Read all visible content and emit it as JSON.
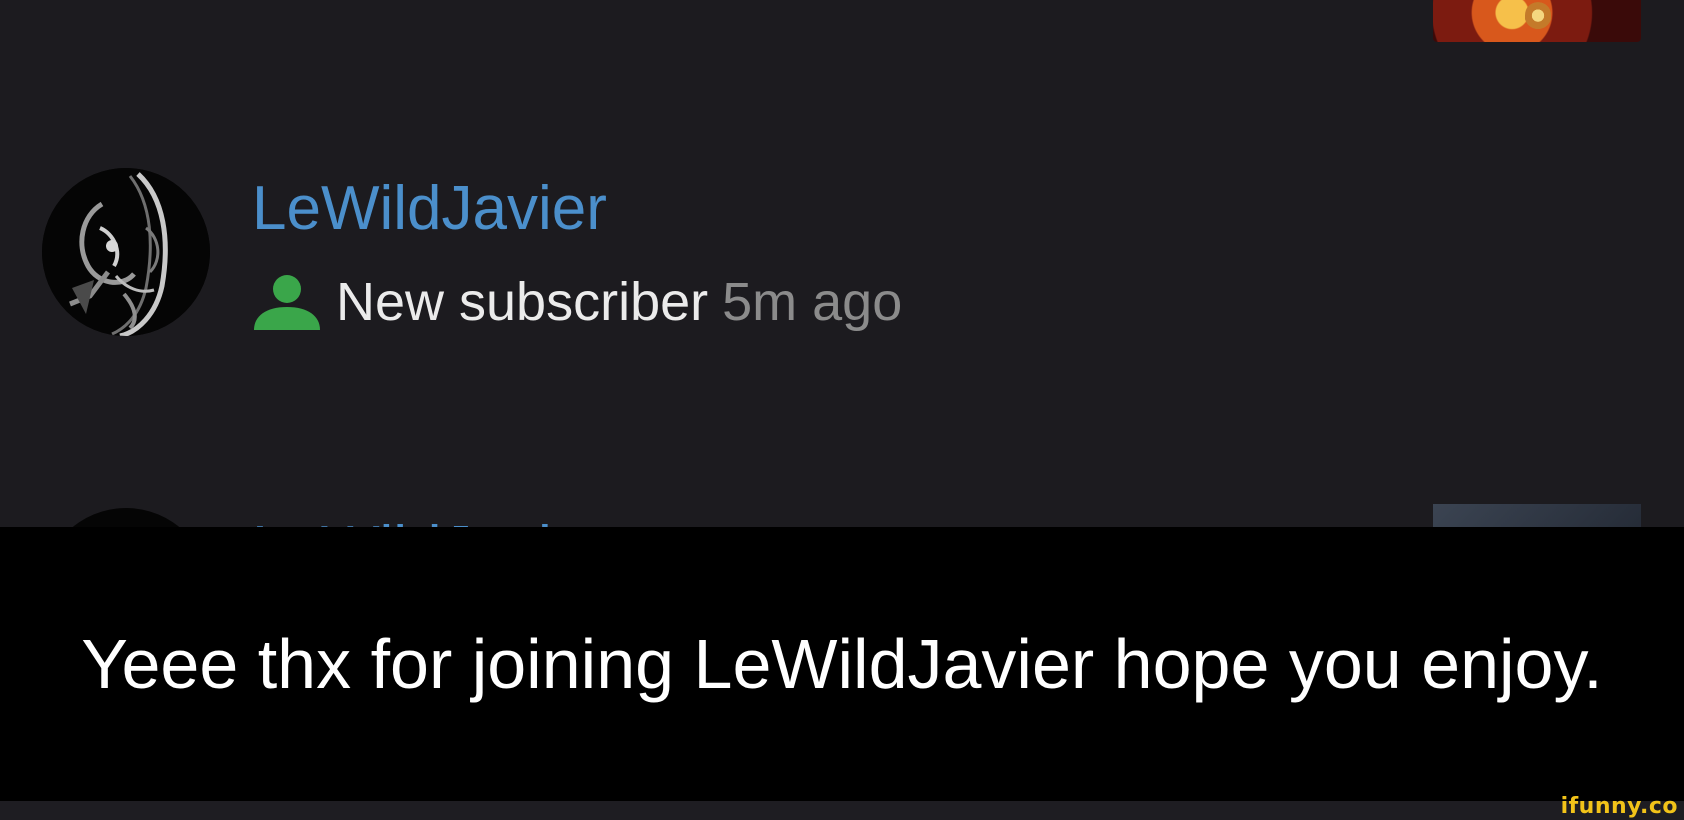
{
  "notification": {
    "username": "LeWildJavier",
    "event_text": "New subscriber",
    "time_ago": "5m ago",
    "event_icon": "person-icon",
    "icon_color": "#3aa64a",
    "username_color": "#4b8fcb"
  },
  "next_notification": {
    "username": "LeWildJavier"
  },
  "caption": {
    "text": "Yeee thx for joining LeWildJavier hope you enjoy."
  },
  "watermark": {
    "text": "ifunny.co",
    "color": "#f2c319"
  }
}
